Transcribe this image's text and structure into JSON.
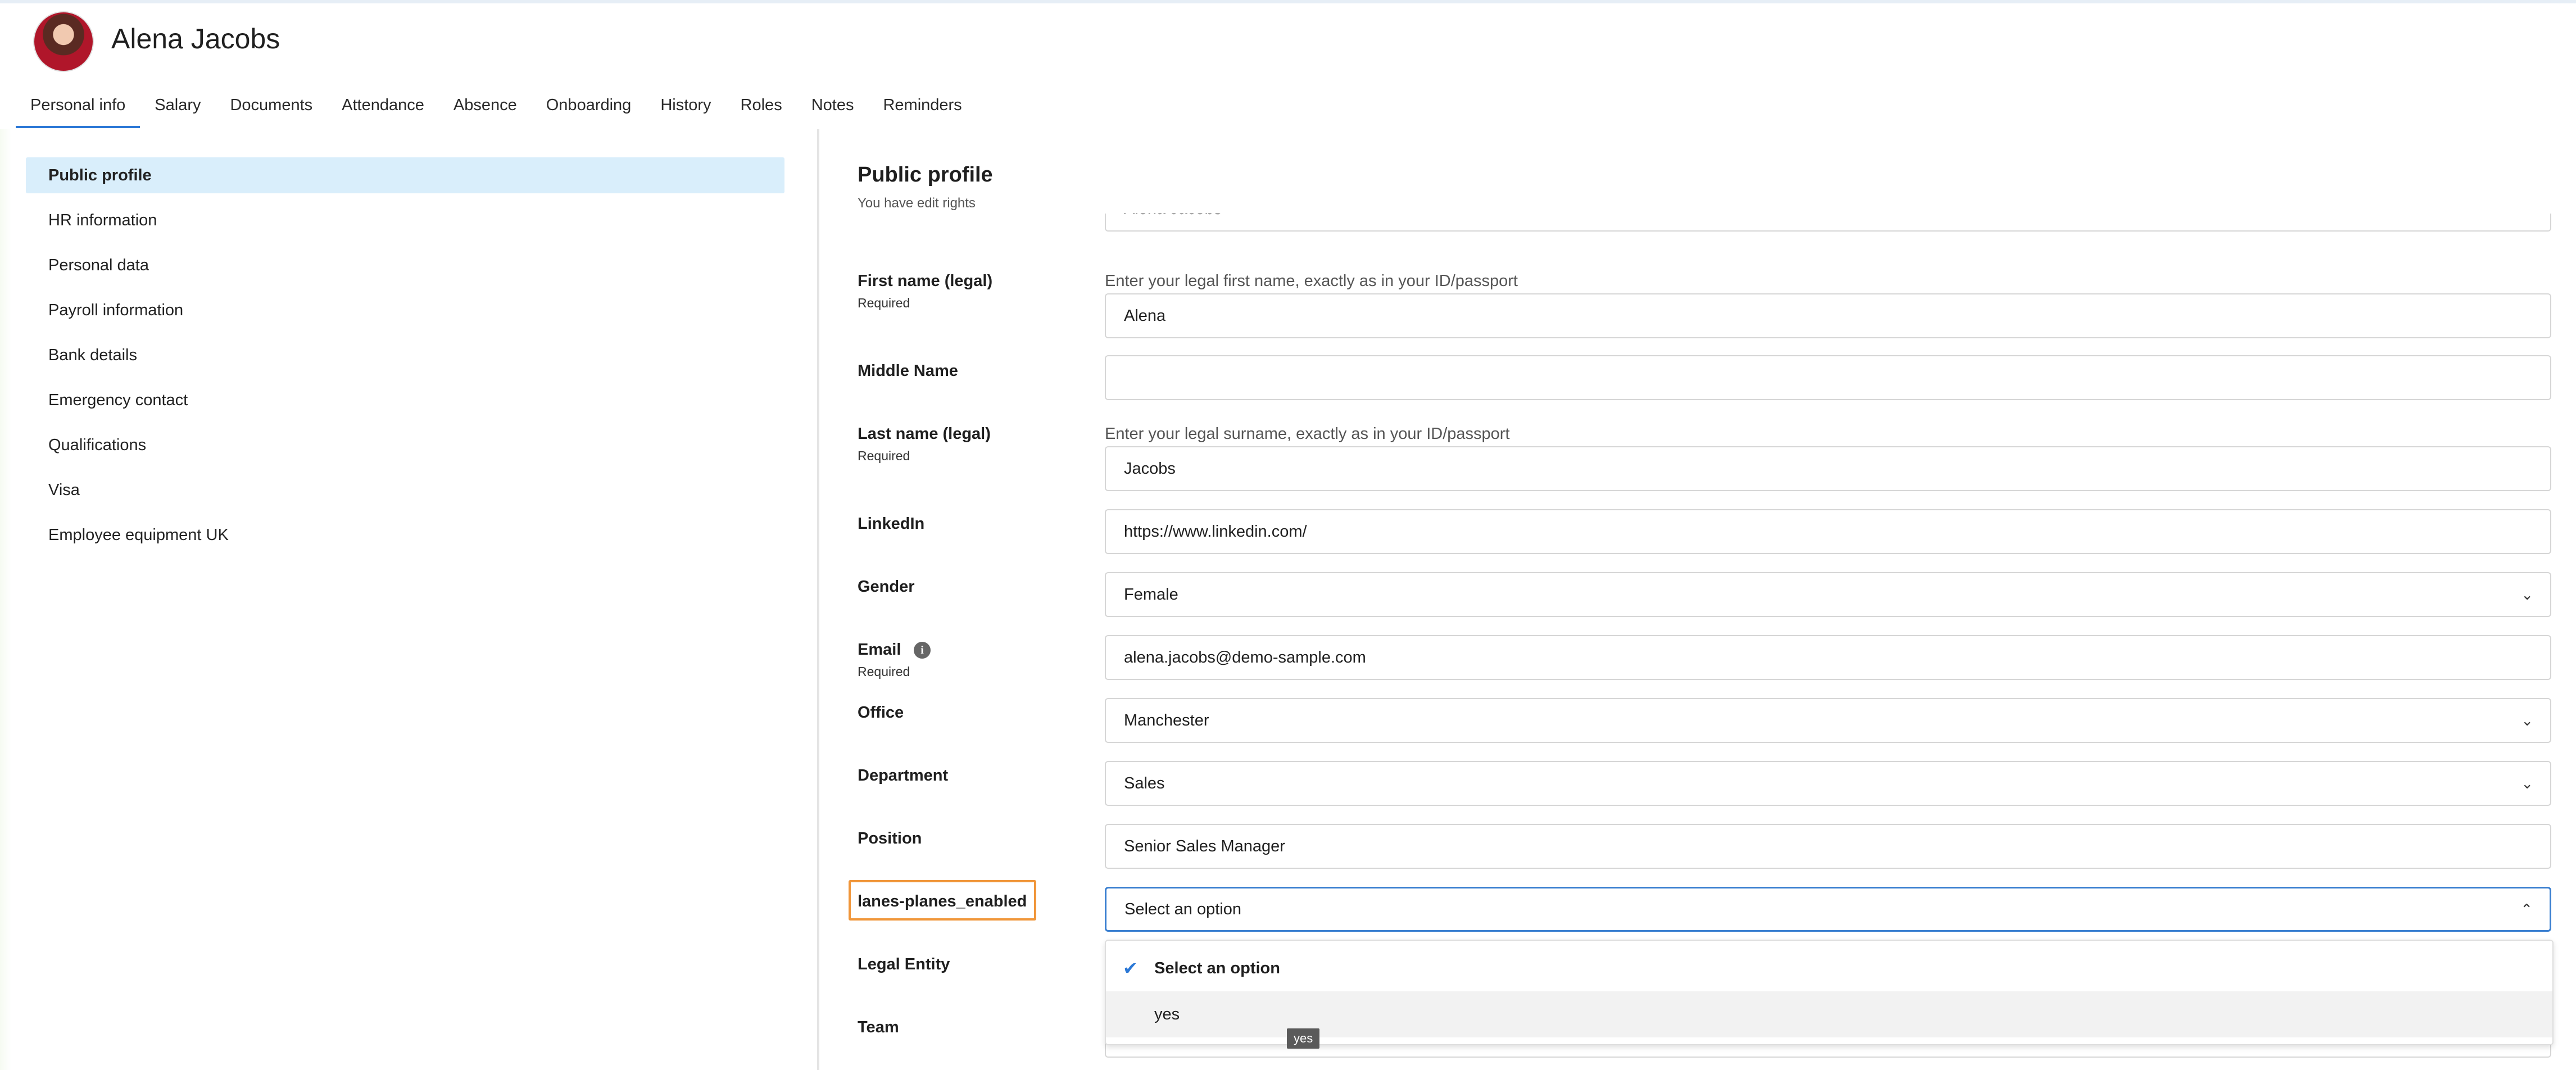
{
  "employee": {
    "name": "Alena Jacobs"
  },
  "tabs": [
    {
      "label": "Personal info",
      "active": true
    },
    {
      "label": "Salary"
    },
    {
      "label": "Documents"
    },
    {
      "label": "Attendance"
    },
    {
      "label": "Absence"
    },
    {
      "label": "Onboarding"
    },
    {
      "label": "History"
    },
    {
      "label": "Roles"
    },
    {
      "label": "Notes"
    },
    {
      "label": "Reminders"
    }
  ],
  "sidebar": {
    "items": [
      {
        "label": "Public profile",
        "active": true
      },
      {
        "label": "HR information"
      },
      {
        "label": "Personal data"
      },
      {
        "label": "Payroll information"
      },
      {
        "label": "Bank details"
      },
      {
        "label": "Emergency contact"
      },
      {
        "label": "Qualifications"
      },
      {
        "label": "Visa"
      },
      {
        "label": "Employee equipment UK"
      }
    ]
  },
  "section": {
    "title": "Public profile",
    "subtitle": "You have edit rights"
  },
  "form": {
    "partial_value": "Alena Jacobs",
    "first_name": {
      "label": "First name (legal)",
      "required": "Required",
      "hint": "Enter your legal first name, exactly as in your ID/passport",
      "value": "Alena"
    },
    "middle_name": {
      "label": "Middle Name",
      "value": ""
    },
    "last_name": {
      "label": "Last name (legal)",
      "required": "Required",
      "hint": "Enter your legal surname, exactly as in your ID/passport",
      "value": "Jacobs"
    },
    "linkedin": {
      "label": "LinkedIn",
      "value": "https://www.linkedin.com/"
    },
    "gender": {
      "label": "Gender",
      "value": "Female"
    },
    "email": {
      "label": "Email",
      "required": "Required",
      "value": "alena.jacobs@demo-sample.com"
    },
    "office": {
      "label": "Office",
      "value": "Manchester"
    },
    "department": {
      "label": "Department",
      "value": "Sales"
    },
    "position": {
      "label": "Position",
      "value": "Senior Sales Manager"
    },
    "lanes": {
      "label": "lanes-planes_enabled",
      "value": "Select an option"
    },
    "legal_entity": {
      "label": "Legal Entity"
    },
    "team": {
      "label": "Team"
    }
  },
  "dropdown": {
    "options": [
      {
        "label": "Select an option",
        "selected": true
      },
      {
        "label": "yes"
      }
    ],
    "tooltip": "yes"
  },
  "icons": {
    "check": "check-icon",
    "chevron_down": "chevron-down-icon",
    "chevron_up": "chevron-up-icon",
    "info": "info-icon"
  },
  "colors": {
    "accent": "#2b78d6",
    "highlight": "#f0963a",
    "active_nav_bg": "#d9eefb"
  }
}
